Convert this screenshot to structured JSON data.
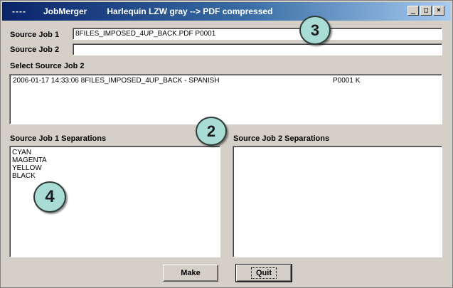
{
  "window": {
    "title_dashes": "----",
    "app_name": "JobMerger",
    "title": "Harlequin LZW gray --> PDF compressed",
    "controls": {
      "minimize": "_",
      "maximize": "□",
      "close": "×"
    }
  },
  "source_job_1": {
    "label": "Source Job 1",
    "value": "8FILES_IMPOSED_4UP_BACK.PDF P0001"
  },
  "source_job_2": {
    "label": "Source Job 2",
    "value": ""
  },
  "select_source_job_2": {
    "label": "Select Source Job 2",
    "rows": [
      {
        "col1": "2006-01-17  14:33:06  8FILES_IMPOSED_4UP_BACK - SPANISH",
        "col2": "P0001 K"
      }
    ]
  },
  "separations_1": {
    "label": "Source Job 1 Separations",
    "items": [
      "CYAN",
      "MAGENTA",
      "YELLOW",
      "BLACK"
    ]
  },
  "separations_2": {
    "label": "Source Job 2 Separations",
    "items": []
  },
  "buttons": {
    "make": "Make",
    "quit": "Quit"
  },
  "callouts": {
    "c2": "2",
    "c3": "3",
    "c4": "4"
  },
  "colors": {
    "callout_fill": "#a8dcd4",
    "title_bar": "#0a246a",
    "window_face": "#d4d0c8"
  }
}
